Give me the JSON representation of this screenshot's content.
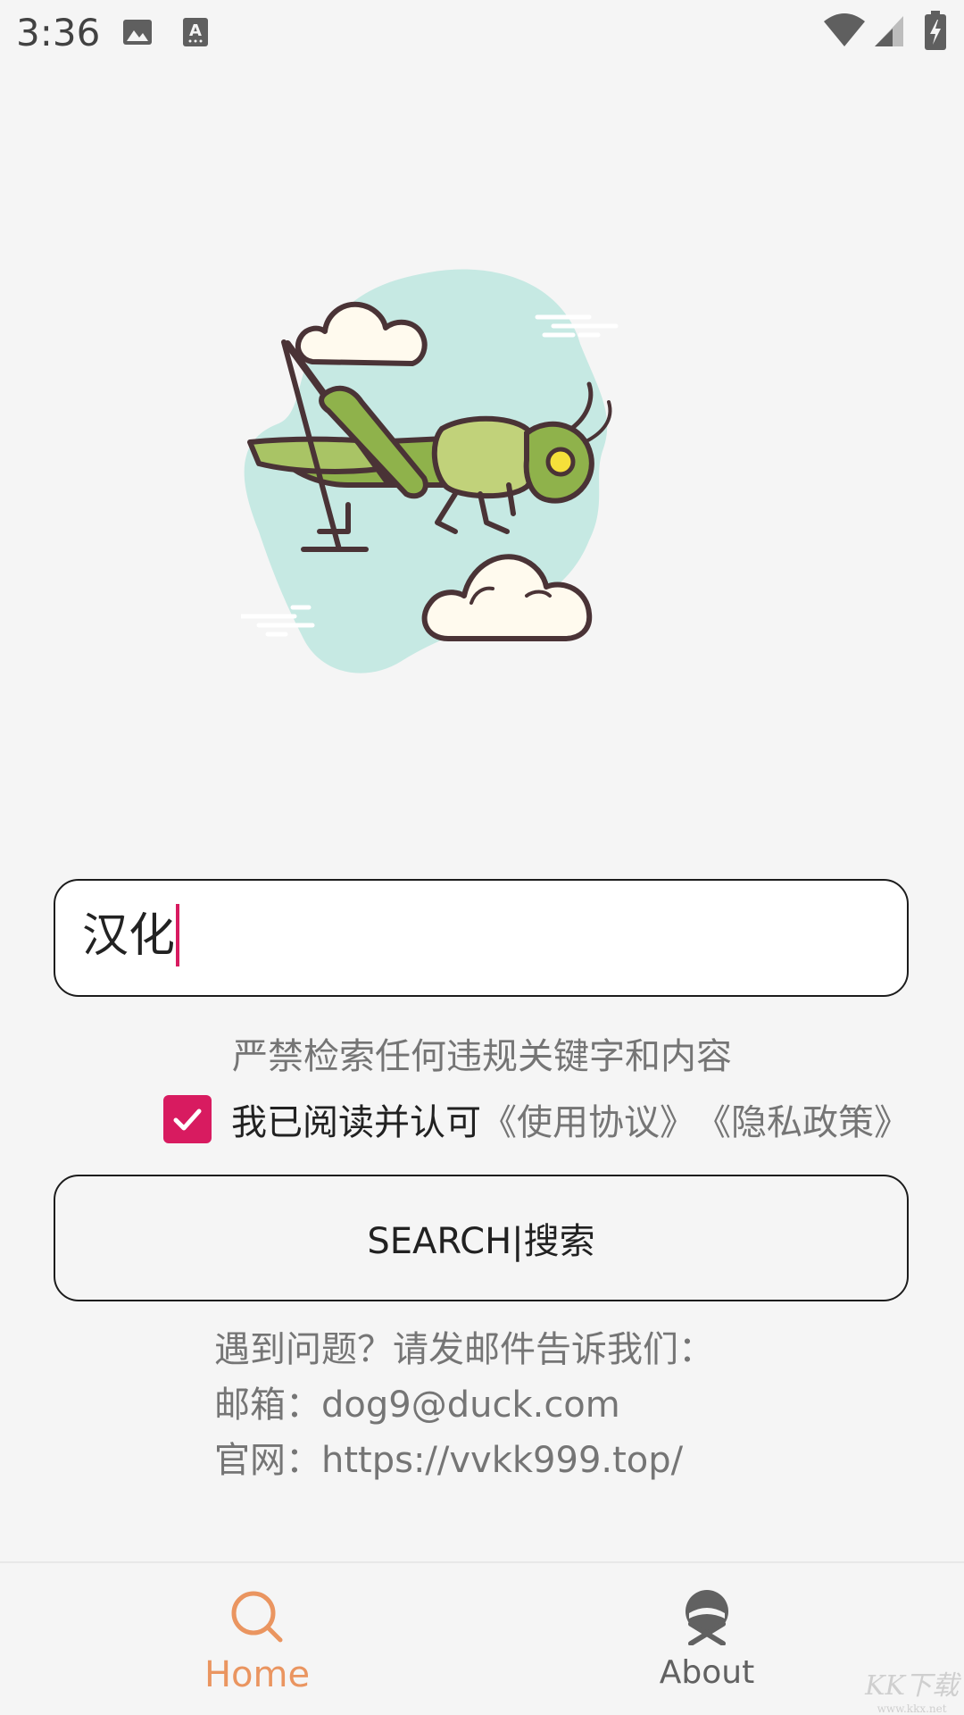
{
  "status_bar": {
    "time": "3:36",
    "icons": [
      "image-icon",
      "text-a-icon",
      "wifi-icon",
      "signal-icon",
      "battery-charging-icon"
    ]
  },
  "search": {
    "value": "汉化",
    "warning": "严禁检索任何违规关键字和内容"
  },
  "agreement": {
    "checked": true,
    "label": "我已阅读并认可",
    "terms_link": "《使用协议》",
    "privacy_link": "《隐私政策》"
  },
  "search_button": {
    "label": "SEARCH|搜索"
  },
  "contact": {
    "line1": "遇到问题？请发邮件告诉我们：",
    "line2": "邮箱：dog9@duck.com",
    "line3": "官网：https://vvkk999.top/"
  },
  "bottom_nav": {
    "items": [
      {
        "label": "Home",
        "icon": "search-icon",
        "active": true
      },
      {
        "label": "About",
        "icon": "about-icon",
        "active": false
      }
    ]
  },
  "watermark": {
    "logo": "KK下载",
    "url": "www.kkx.net"
  },
  "colors": {
    "accent": "#d81b60",
    "nav_active": "#ea9560",
    "nav_inactive": "#616161",
    "background": "#f5f5f5"
  }
}
